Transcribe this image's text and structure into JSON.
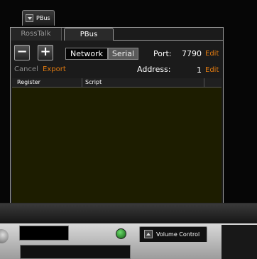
{
  "top_tab": {
    "label": "PBus"
  },
  "tabs": [
    {
      "label": "RossTalk",
      "active": false
    },
    {
      "label": "PBus",
      "active": true
    }
  ],
  "toolbar": {
    "remove_label": "−",
    "add_label": "+",
    "mode_network": "Network",
    "mode_serial": "Serial",
    "selected_mode": "Network",
    "port_label": "Port:",
    "port_value": "7790",
    "port_edit": "Edit",
    "cancel_label": "Cancel",
    "export_label": "Export",
    "address_label": "Address:",
    "address_value": "1",
    "address_edit": "Edit"
  },
  "grid": {
    "columns": [
      "Register",
      "Script"
    ],
    "rows": []
  },
  "bottom": {
    "volume_tab_label": "Volume Control"
  },
  "colors": {
    "accent_orange": "#e07a10",
    "grid_background": "#1d1d00",
    "indicator_green": "#3cb43c"
  }
}
